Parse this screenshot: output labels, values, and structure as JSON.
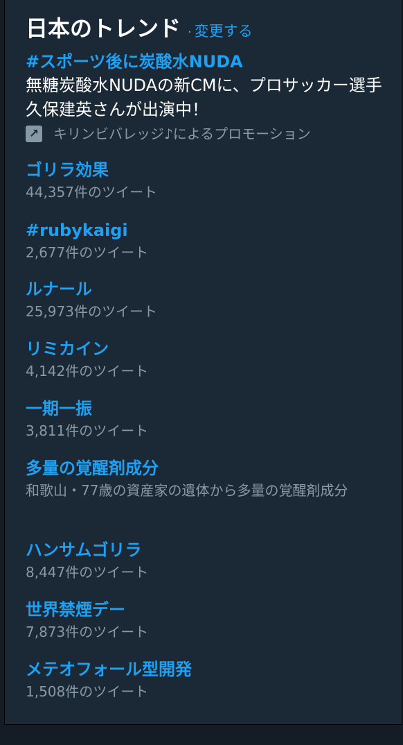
{
  "header": {
    "title": "日本のトレンド",
    "separator": "·",
    "change_link": "変更する"
  },
  "promoted": {
    "name": "#スポーツ後に炭酸水NUDA",
    "description": "無糖炭酸水NUDAの新CMに、プロサッカー選手久保建英さんが出演中！",
    "promo_icon": "promoted-arrow-icon",
    "promo_text": "キリンビバレッジ♪によるプロモーション"
  },
  "trends": [
    {
      "name": "ゴリラ効果",
      "sub": "44,357件のツイート"
    },
    {
      "name": "#rubykaigi",
      "sub": "2,677件のツイート"
    },
    {
      "name": "ルナール",
      "sub": "25,973件のツイート"
    },
    {
      "name": "リミカイン",
      "sub": "4,142件のツイート"
    },
    {
      "name": "一期一振",
      "sub": "3,811件のツイート"
    },
    {
      "name": "多量の覚醒剤成分",
      "sub": "和歌山・77歳の資産家の遺体から多量の覚醒剤成分"
    },
    {
      "name": "ハンサムゴリラ",
      "sub": "8,447件のツイート"
    },
    {
      "name": "世界禁煙デー",
      "sub": "7,873件のツイート"
    },
    {
      "name": "メテオフォール型開発",
      "sub": "1,508件のツイート"
    }
  ],
  "colors": {
    "accent": "#1da1f2",
    "background": "#1b2836",
    "muted": "#8899a6"
  }
}
